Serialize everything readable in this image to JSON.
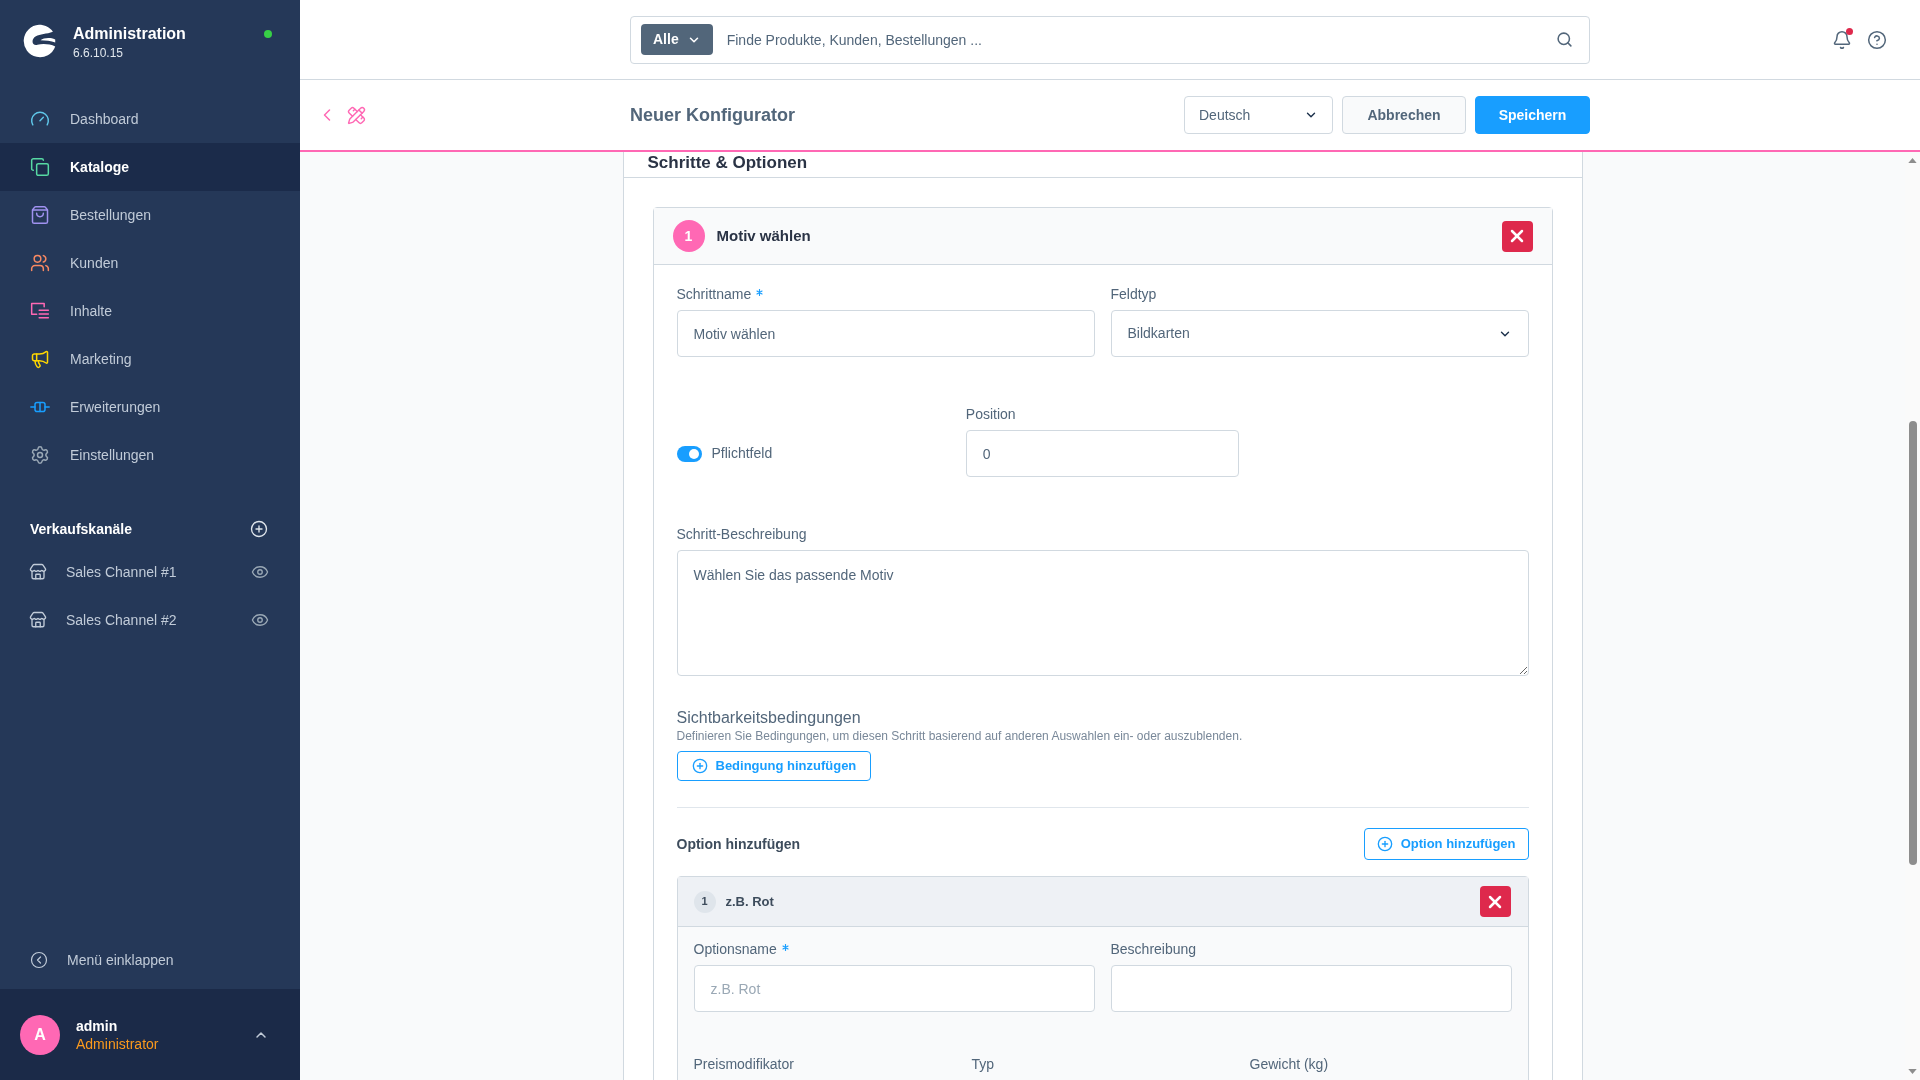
{
  "sidebar": {
    "brand": {
      "title": "Administration",
      "version": "6.6.10.15",
      "online": true
    },
    "nav": [
      {
        "label": "Dashboard",
        "color": "#5fc6e8",
        "selected": false
      },
      {
        "label": "Kataloge",
        "color": "#57d9a3",
        "selected": true
      },
      {
        "label": "Bestellungen",
        "color": "#a092f0",
        "selected": false
      },
      {
        "label": "Kunden",
        "color": "#f88962",
        "selected": false
      },
      {
        "label": "Inhalte",
        "color": "#ff68b4",
        "selected": false
      },
      {
        "label": "Marketing",
        "color": "#ffd700",
        "selected": false
      },
      {
        "label": "Erweiterungen",
        "color": "#189eff",
        "selected": false
      },
      {
        "label": "Einstellungen",
        "color": "#9aa8b5",
        "selected": false
      }
    ],
    "sales_channels": {
      "title": "Verkaufskanäle",
      "items": [
        {
          "label": "Sales Channel #1"
        },
        {
          "label": "Sales Channel #2"
        }
      ]
    },
    "collapse_label": "Menü einklappen",
    "user": {
      "initial": "A",
      "name": "admin",
      "role": "Administrator"
    }
  },
  "header": {
    "search": {
      "scope": "Alle",
      "placeholder": "Finde Produkte, Kunden, Bestellungen ..."
    },
    "notifications": {
      "unread": true
    }
  },
  "smart_bar": {
    "title": "Neuer Konfigurator",
    "language": "Deutsch",
    "buttons": [
      {
        "label": "Abbrechen",
        "kind": "secondary"
      },
      {
        "label": "Speichern",
        "kind": "primary"
      }
    ]
  },
  "card": {
    "title": "Schritte & Optionen",
    "steps": [
      {
        "number": "1",
        "title": "Motiv wählen",
        "name_field": {
          "label": "Schrittname",
          "required": true,
          "value": "Motiv wählen"
        },
        "type_field": {
          "label": "Feldtyp",
          "required": false,
          "value": "Bildkarten"
        },
        "required_switch": {
          "label": "Pflichtfeld",
          "on": true
        },
        "position_field": {
          "label": "Position",
          "required": false,
          "value": "0"
        },
        "description_field": {
          "label": "Schritt-Beschreibung",
          "required": false,
          "value": "Wählen Sie das passende Motiv"
        },
        "visibility": {
          "title": "Sichtbarkeitsbedingungen",
          "help": "Definieren Sie Bedingungen, um diesen Schritt basierend auf anderen Auswahlen ein- oder auszublenden.",
          "button": "Bedingung hinzufügen"
        },
        "options": {
          "title": "Option hinzufügen",
          "button": "Option hinzufügen",
          "items": [
            {
              "number": "1",
              "title": "z.B. Rot",
              "name_field": {
                "label": "Optionsname",
                "required": true,
                "placeholder": "z.B. Rot"
              },
              "description_field": {
                "label": "Beschreibung",
                "required": false
              },
              "more_labels": [
                "Preismodifikator",
                "Typ",
                "Gewicht (kg)"
              ]
            }
          ]
        }
      }
    ]
  }
}
